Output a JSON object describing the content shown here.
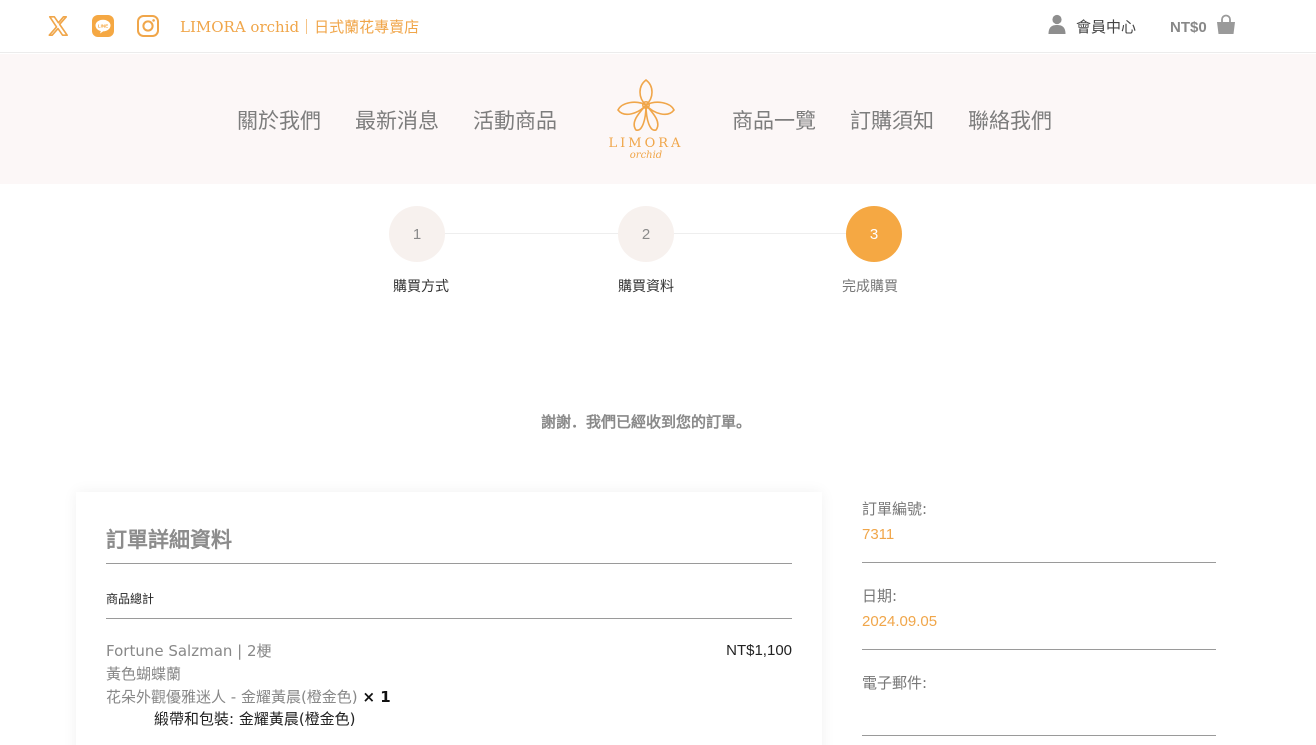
{
  "topbar": {
    "social_icons": [
      "x-icon",
      "line-icon",
      "instagram-icon"
    ],
    "brand_text": "LIMORA orchid｜日式蘭花專賣店",
    "member_label": "會員中心",
    "cart_total": "NT$0"
  },
  "nav": {
    "left": [
      "關於我們",
      "最新消息",
      "活動商品"
    ],
    "right": [
      "商品一覽",
      "訂購須知",
      "聯絡我們"
    ],
    "logo_word": "LIMORA",
    "logo_sub": "orchid"
  },
  "steps": [
    {
      "number": "1",
      "label": "購買方式"
    },
    {
      "number": "2",
      "label": "購買資料"
    },
    {
      "number": "3",
      "label": "完成購買"
    }
  ],
  "active_step": 3,
  "thanks_message": "謝謝．我們已經收到您的訂單。",
  "order_details": {
    "title": "訂單詳細資料",
    "subtotal_label": "商品總計",
    "product": {
      "name": "Fortune Salzman | 2梗",
      "type": "黃色蝴蝶蘭",
      "variant": "花朵外觀優雅迷人 - 金耀黃晨(橙金色)",
      "quantity": "× 1",
      "price": "NT$1,100",
      "option": "緞帶和包裝: 金耀黃晨(橙金色)"
    }
  },
  "order_info": {
    "number_label": "訂單編號:",
    "number_value": "7311",
    "date_label": "日期:",
    "date_value": "2024.09.05",
    "email_label": "電子郵件:",
    "email_value": ""
  },
  "colors": {
    "accent": "#f5a843",
    "brand_text": "#f0a64a",
    "nav_background": "#fcf7f7",
    "step_inactive": "#f7f1ee"
  }
}
